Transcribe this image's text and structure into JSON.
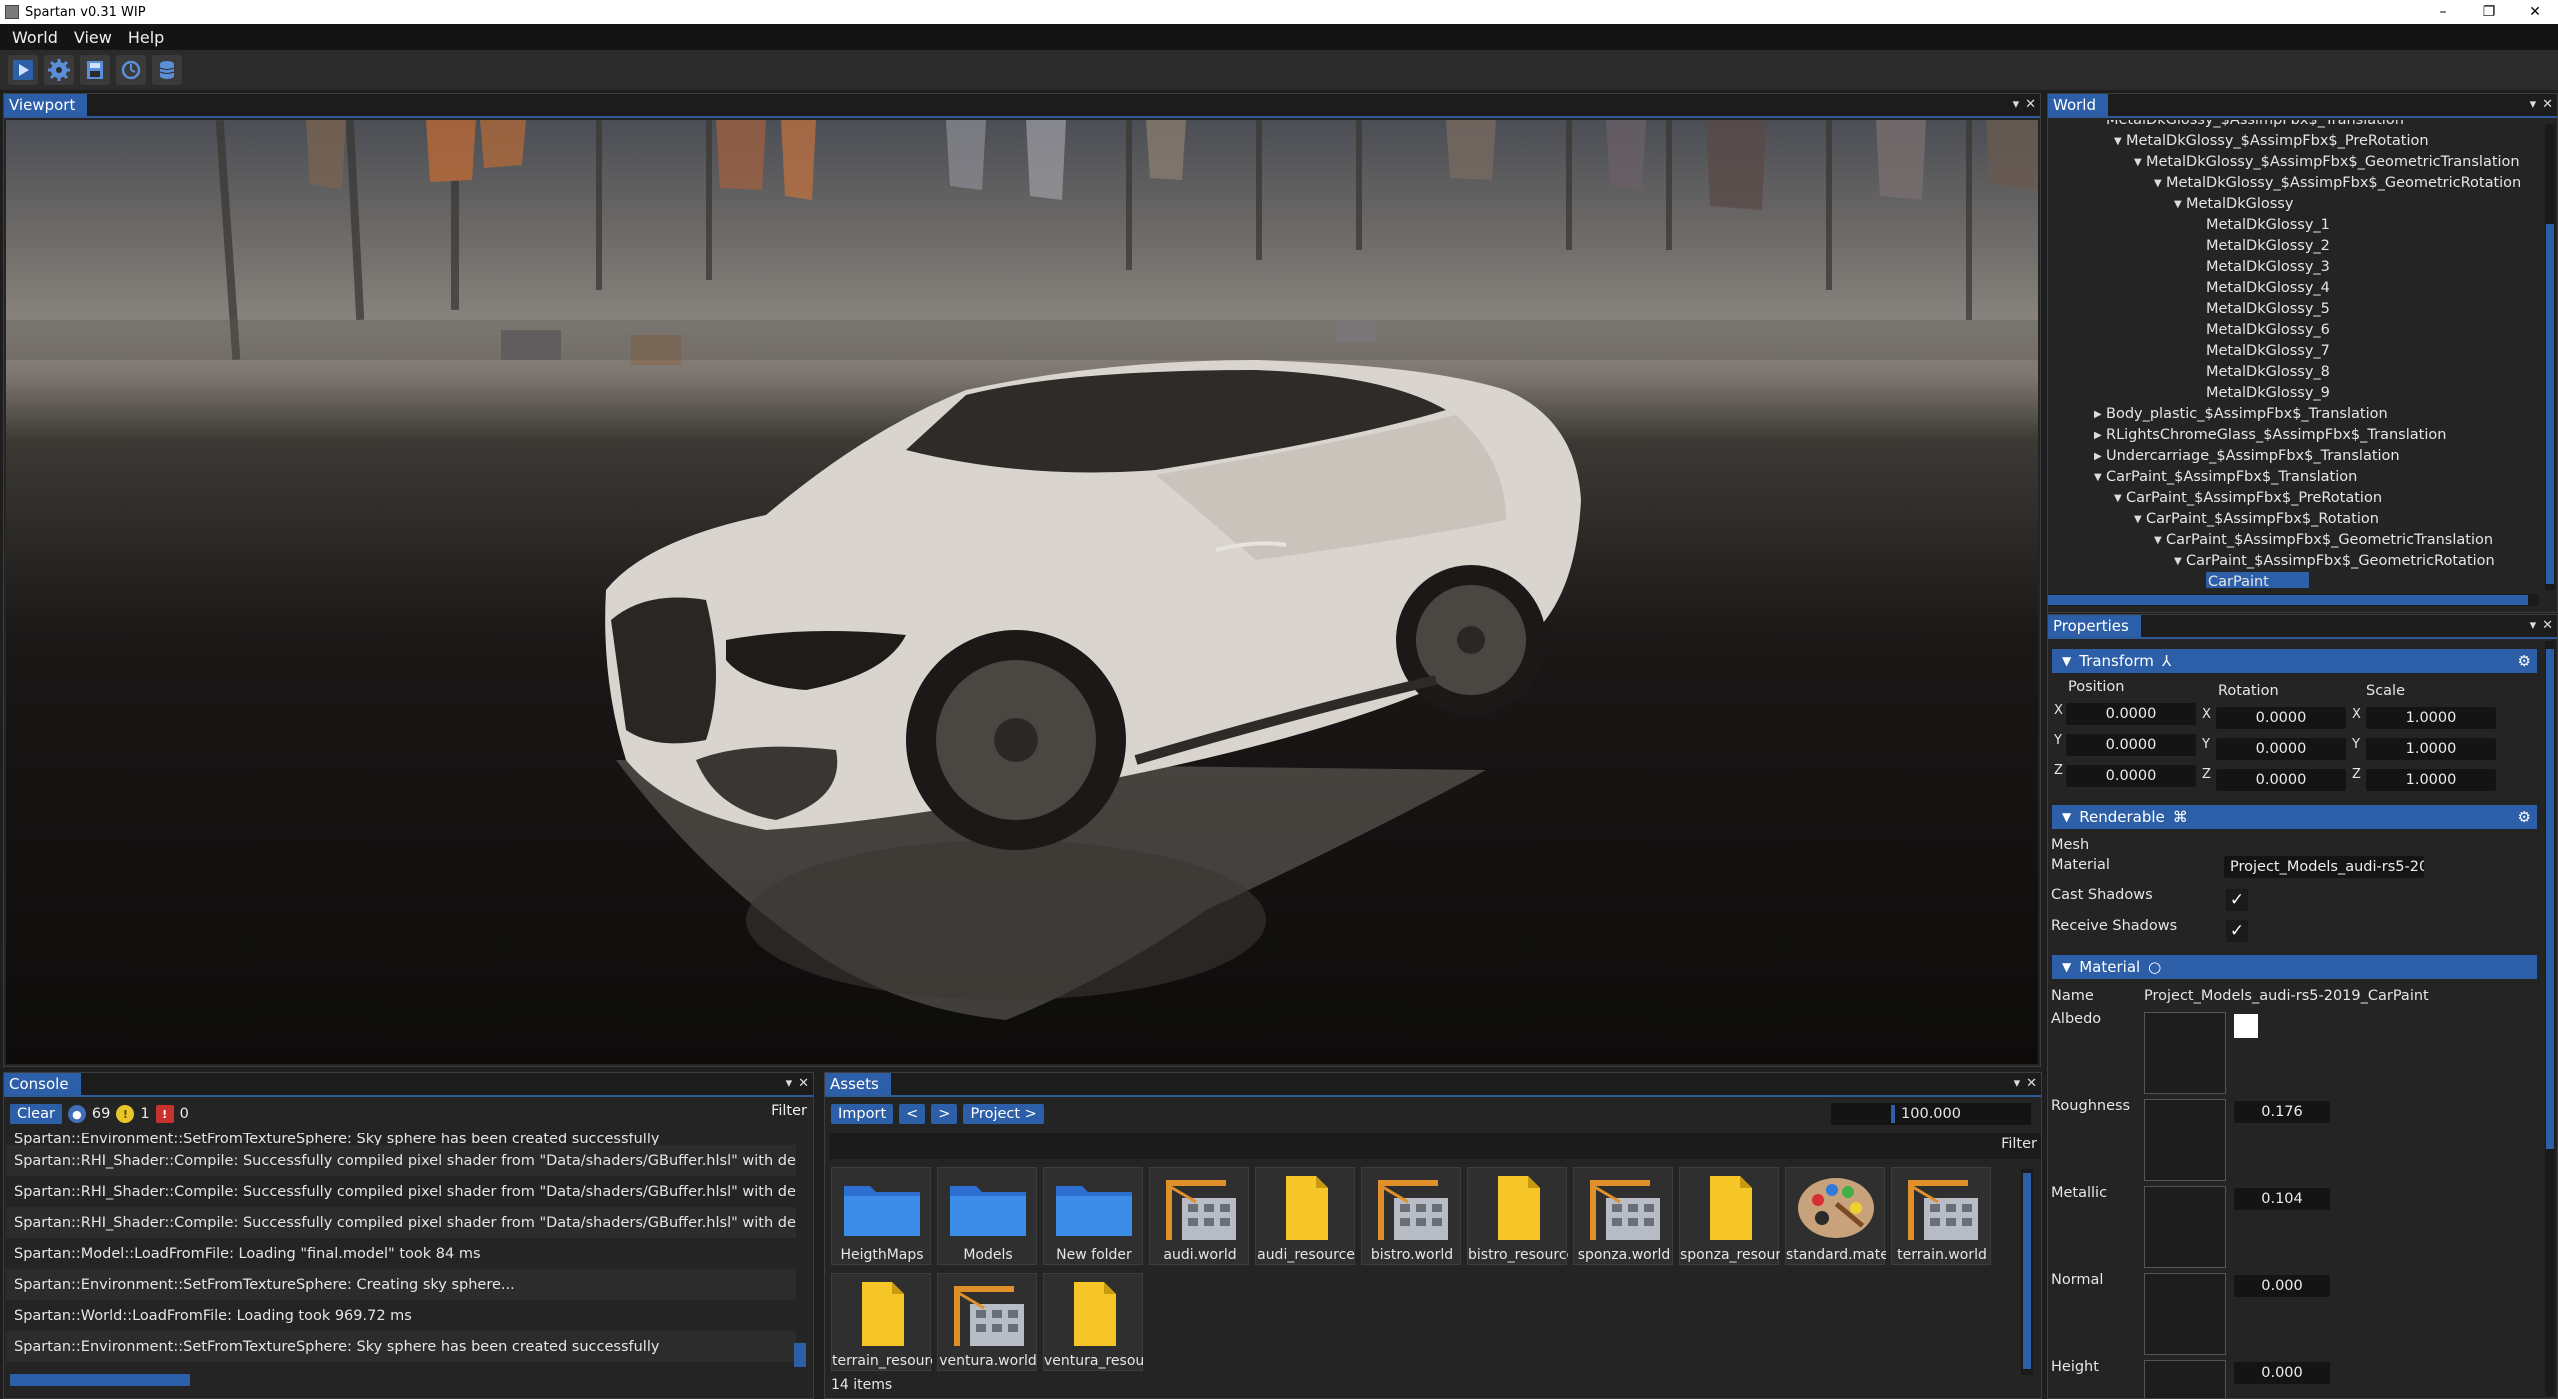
{
  "window": {
    "title": "Spartan v0.31 WIP",
    "minimize": "–",
    "maximize": "❐",
    "close": "✕"
  },
  "menu": [
    "World",
    "View",
    "Help"
  ],
  "toolbar": [
    "play-icon",
    "settings-icon",
    "save-icon",
    "profiler-icon",
    "resource-cache-icon"
  ],
  "panels": {
    "viewport": "Viewport",
    "world": "World",
    "properties": "Properties",
    "console": "Console",
    "assets": "Assets",
    "dock": "▾",
    "close": "✕"
  },
  "world_tree": [
    {
      "indent": 3,
      "arrow": "",
      "label": "MetalDkGlossy_$AssimpFbx$_Translation"
    },
    {
      "indent": 4,
      "arrow": "▼",
      "label": "MetalDkGlossy_$AssimpFbx$_PreRotation"
    },
    {
      "indent": 5,
      "arrow": "▼",
      "label": "MetalDkGlossy_$AssimpFbx$_GeometricTranslation"
    },
    {
      "indent": 6,
      "arrow": "▼",
      "label": "MetalDkGlossy_$AssimpFbx$_GeometricRotation"
    },
    {
      "indent": 7,
      "arrow": "▼",
      "label": "MetalDkGlossy"
    },
    {
      "indent": 8,
      "arrow": "",
      "label": "MetalDkGlossy_1"
    },
    {
      "indent": 8,
      "arrow": "",
      "label": "MetalDkGlossy_2"
    },
    {
      "indent": 8,
      "arrow": "",
      "label": "MetalDkGlossy_3"
    },
    {
      "indent": 8,
      "arrow": "",
      "label": "MetalDkGlossy_4"
    },
    {
      "indent": 8,
      "arrow": "",
      "label": "MetalDkGlossy_5"
    },
    {
      "indent": 8,
      "arrow": "",
      "label": "MetalDkGlossy_6"
    },
    {
      "indent": 8,
      "arrow": "",
      "label": "MetalDkGlossy_7"
    },
    {
      "indent": 8,
      "arrow": "",
      "label": "MetalDkGlossy_8"
    },
    {
      "indent": 8,
      "arrow": "",
      "label": "MetalDkGlossy_9"
    },
    {
      "indent": 3,
      "arrow": "▶",
      "label": "Body_plastic_$AssimpFbx$_Translation"
    },
    {
      "indent": 3,
      "arrow": "▶",
      "label": "RLightsChromeGlass_$AssimpFbx$_Translation"
    },
    {
      "indent": 3,
      "arrow": "▶",
      "label": "Undercarriage_$AssimpFbx$_Translation"
    },
    {
      "indent": 3,
      "arrow": "▼",
      "label": "CarPaint_$AssimpFbx$_Translation"
    },
    {
      "indent": 4,
      "arrow": "▼",
      "label": "CarPaint_$AssimpFbx$_PreRotation"
    },
    {
      "indent": 5,
      "arrow": "▼",
      "label": "CarPaint_$AssimpFbx$_Rotation"
    },
    {
      "indent": 6,
      "arrow": "▼",
      "label": "CarPaint_$AssimpFbx$_GeometricTranslation"
    },
    {
      "indent": 7,
      "arrow": "▼",
      "label": "CarPaint_$AssimpFbx$_GeometricRotation"
    },
    {
      "indent": 8,
      "arrow": "",
      "label": "CarPaint",
      "selected": true
    }
  ],
  "transform": {
    "title": "Transform",
    "position_label": "Position",
    "rotation_label": "Rotation",
    "scale_label": "Scale",
    "axes": [
      "X",
      "Y",
      "Z"
    ],
    "position": [
      "0.0000",
      "0.0000",
      "0.0000"
    ],
    "rotation": [
      "0.0000",
      "0.0000",
      "0.0000"
    ],
    "scale": [
      "1.0000",
      "1.0000",
      "1.0000"
    ]
  },
  "renderable": {
    "title": "Renderable",
    "mesh_label": "Mesh",
    "material_label": "Material",
    "material_value": "Project_Models_audi-rs5-20",
    "cast_shadows_label": "Cast Shadows",
    "cast_shadows": true,
    "receive_shadows_label": "Receive Shadows",
    "receive_shadows": true,
    "checkmark": "✓"
  },
  "material": {
    "title": "Material",
    "name_label": "Name",
    "name_value": "Project_Models_audi-rs5-2019_CarPaint",
    "albedo_label": "Albedo",
    "roughness_label": "Roughness",
    "roughness": "0.176",
    "metallic_label": "Metallic",
    "metallic": "0.104",
    "normal_label": "Normal",
    "normal": "0.000",
    "height_label": "Height",
    "height": "0.000"
  },
  "console": {
    "clear": "Clear",
    "info_count": "69",
    "warning_count": "1",
    "error_count": "0",
    "filter": "Filter",
    "lines": [
      "Spartan::Environment::SetFromTextureSphere: Sky sphere has been created successfully",
      "Spartan::RHI_Shader::Compile: Successfully compiled pixel shader from \"Data/shaders/GBuffer.hlsl\" with defin",
      "Spartan::RHI_Shader::Compile: Successfully compiled pixel shader from \"Data/shaders/GBuffer.hlsl\" with defin",
      "Spartan::RHI_Shader::Compile: Successfully compiled pixel shader from \"Data/shaders/GBuffer.hlsl\" with defin",
      "Spartan::Model::LoadFromFile: Loading \"final.model\" took 84 ms",
      "Spartan::Environment::SetFromTextureSphere: Creating sky sphere...",
      "Spartan::World::LoadFromFile: Loading took 969.72 ms",
      "Spartan::Environment::SetFromTextureSphere: Sky sphere has been created successfully"
    ]
  },
  "assets": {
    "import": "Import",
    "back": "<",
    "forward": ">",
    "path": "Project >",
    "zoom": "100.000",
    "filter": "Filter",
    "count": "14 items",
    "items": [
      {
        "name": "HeigthMaps",
        "icon": "folder"
      },
      {
        "name": "Models",
        "icon": "folder"
      },
      {
        "name": "New folder",
        "icon": "folder"
      },
      {
        "name": "audi.world",
        "icon": "world"
      },
      {
        "name": "audi_resource",
        "icon": "file"
      },
      {
        "name": "bistro.world",
        "icon": "world"
      },
      {
        "name": "bistro_resource",
        "icon": "file"
      },
      {
        "name": "sponza.world",
        "icon": "world"
      },
      {
        "name": "sponza_resource",
        "icon": "file"
      },
      {
        "name": "standard.material",
        "icon": "material"
      },
      {
        "name": "terrain.world",
        "icon": "world"
      },
      {
        "name": "terrain_resource",
        "icon": "file"
      },
      {
        "name": "ventura.world",
        "icon": "world"
      },
      {
        "name": "ventura_resource",
        "icon": "file"
      }
    ]
  },
  "colors": {
    "accent": "#2c5fa8",
    "folder": "#3c8de8",
    "file": "#f6c528",
    "world_icon": "#e0902a"
  }
}
